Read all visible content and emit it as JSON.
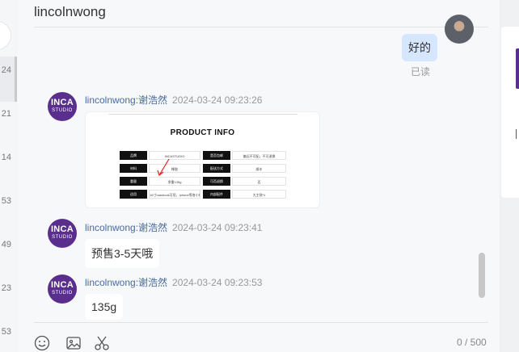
{
  "conversation": {
    "title": "lincolnwong"
  },
  "sidebar_numbers": [
    "24",
    "21",
    "14",
    "53",
    "49",
    "23",
    "53"
  ],
  "self_message": {
    "text": "好的",
    "status": "已读"
  },
  "messages": [
    {
      "sender": "lincolnwong:谢浩然",
      "time": "2024-03-24 09:23:26",
      "type": "image",
      "image": {
        "title": "PRODUCT INFO",
        "rows": [
          [
            "品牌",
            "INCASTUDIO",
            "是否包邮",
            "偏远不可配，不可退换"
          ],
          [
            "材料",
            "橡胶",
            "配送方式",
            "顺丰"
          ],
          [
            "重量",
            "净重135g",
            "可否退换",
            "否"
          ],
          [
            "适用",
            "16寸macbook可用，iphone等各小机，A4纸张，保温杯",
            "内部配件",
            "大主袋*1"
          ]
        ]
      }
    },
    {
      "sender": "lincolnwong:谢浩然",
      "time": "2024-03-24 09:23:41",
      "type": "text",
      "text": "预售3-5天哦"
    },
    {
      "sender": "lincolnwong:谢浩然",
      "time": "2024-03-24 09:23:53",
      "type": "text",
      "text": "135g"
    }
  ],
  "avatar_logo": {
    "line1": "INCA",
    "line2": "STUDIO"
  },
  "toolbar": {
    "icons": [
      "emoji-icon",
      "image-icon",
      "scissors-icon"
    ]
  },
  "input": {
    "counter": "0 / 500"
  },
  "colors": {
    "brand_purple": "#5a2e8c",
    "self_bubble": "#d6e6ff",
    "sender_name": "#4a6a9c"
  }
}
